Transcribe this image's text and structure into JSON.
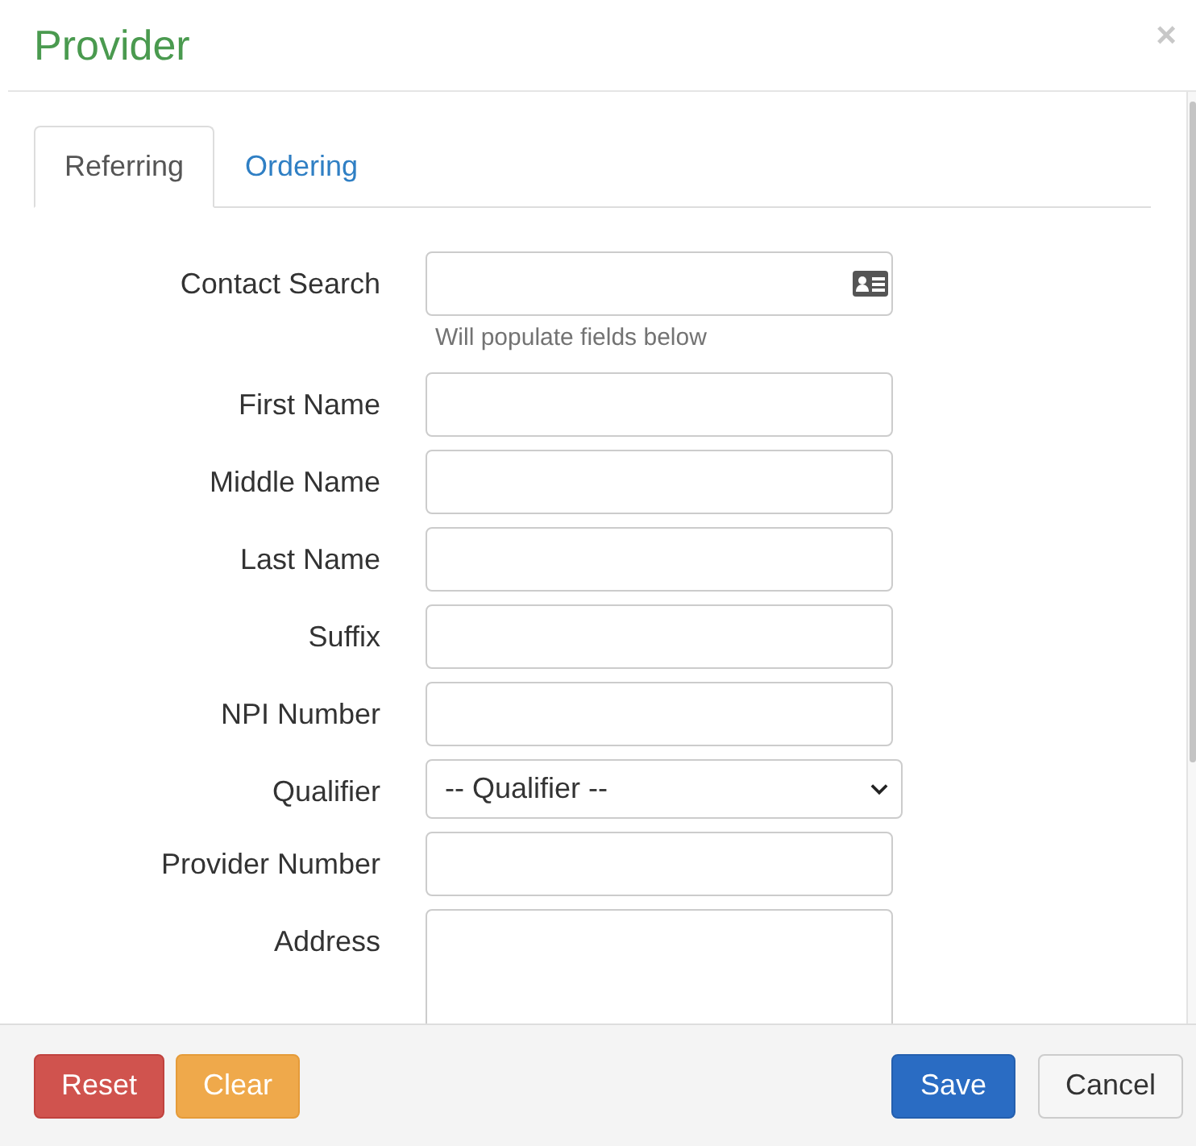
{
  "dialog": {
    "title": "Provider",
    "close": "×"
  },
  "tabs": [
    {
      "label": "Referring",
      "selected": true
    },
    {
      "label": "Ordering",
      "selected": false
    }
  ],
  "fields": [
    {
      "kind": "search",
      "label": "Contact Search",
      "help": "Will populate fields below"
    },
    {
      "kind": "text",
      "label": "First Name"
    },
    {
      "kind": "text",
      "label": "Middle Name"
    },
    {
      "kind": "text",
      "label": "Last Name"
    },
    {
      "kind": "text",
      "label": "Suffix"
    },
    {
      "kind": "text",
      "label": "NPI Number"
    },
    {
      "kind": "select",
      "label": "Qualifier",
      "value": "-- Qualifier --"
    },
    {
      "kind": "text",
      "label": "Provider Number"
    },
    {
      "kind": "textarea",
      "label": "Address"
    }
  ],
  "buttons": [
    {
      "label": "Reset",
      "kind": "danger"
    },
    {
      "label": "Clear",
      "kind": "warning"
    },
    {
      "label": "Save",
      "kind": "primary"
    },
    {
      "label": "Cancel",
      "kind": "default"
    }
  ]
}
